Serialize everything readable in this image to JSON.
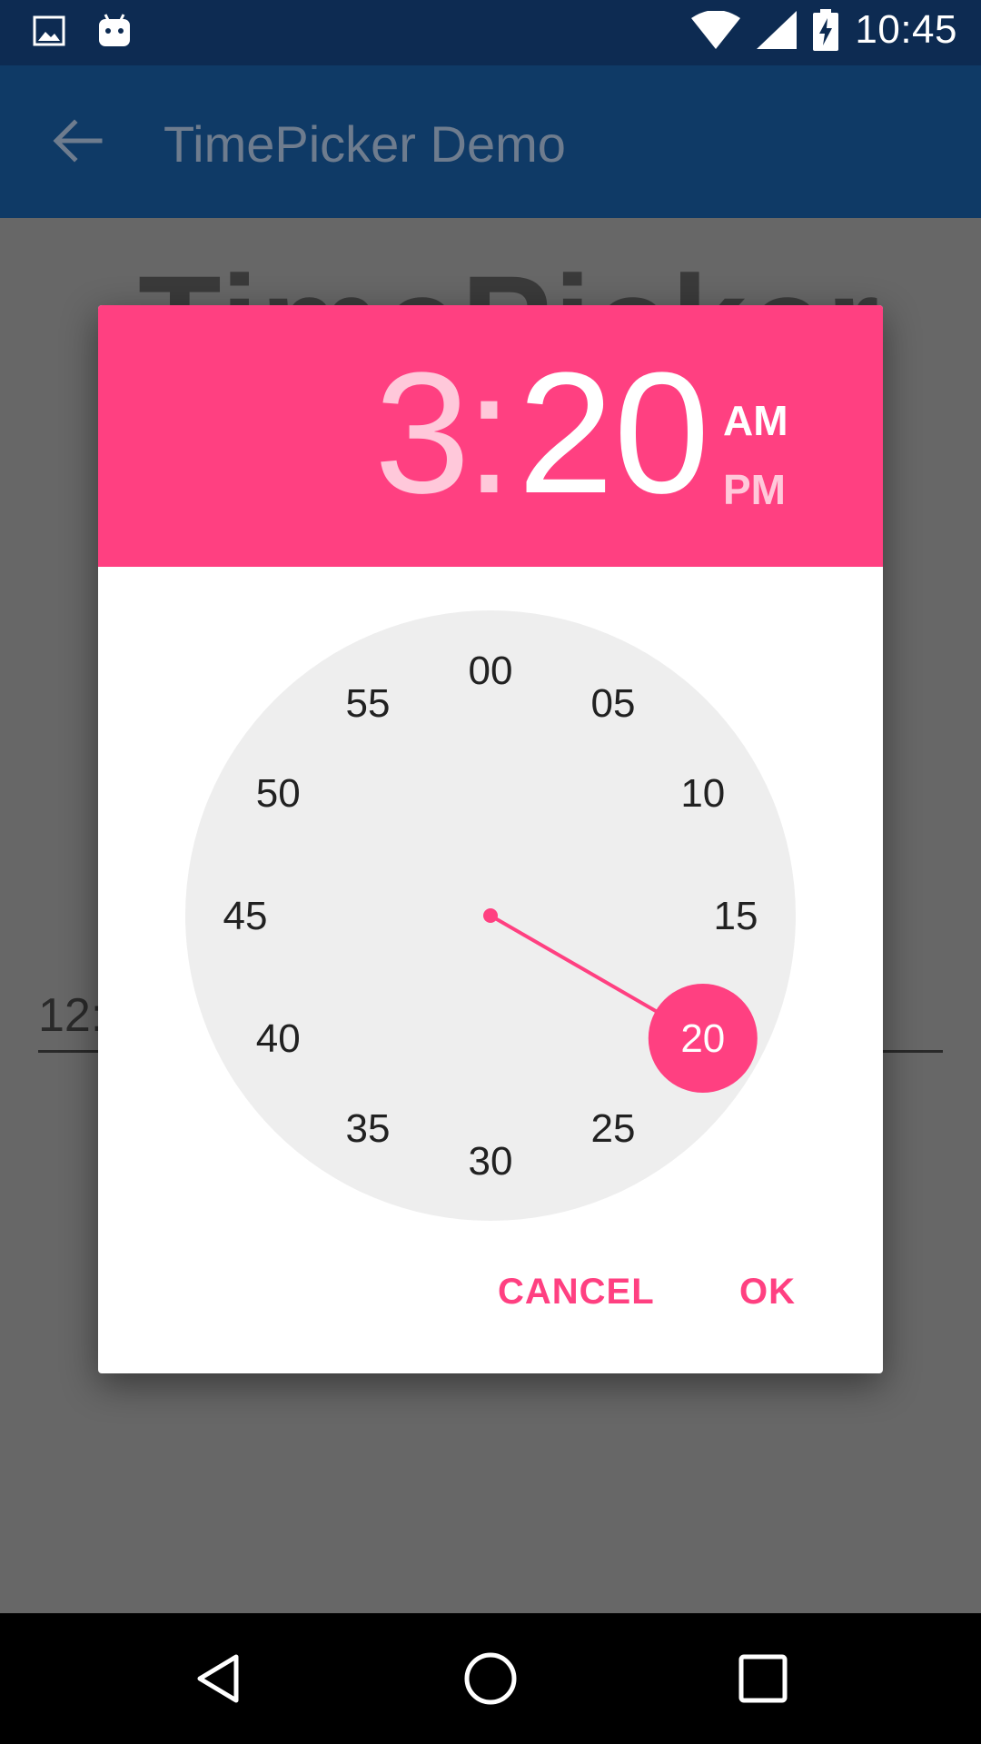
{
  "status_bar": {
    "time": "10:45",
    "icons": [
      "image-icon",
      "android-icon",
      "wifi-icon",
      "signal-icon",
      "battery-charging-icon"
    ]
  },
  "app_bar": {
    "title": "TimePicker Demo",
    "back_icon": "arrow-back-icon"
  },
  "background": {
    "heading": "TimePicker",
    "input_value": "12:"
  },
  "dialog": {
    "header": {
      "hour": "3",
      "separator": ":",
      "minute": "20",
      "am_label": "AM",
      "pm_label": "PM",
      "active_period": "AM"
    },
    "clock": {
      "mode": "minutes",
      "labels": [
        "00",
        "05",
        "10",
        "15",
        "20",
        "25",
        "30",
        "35",
        "40",
        "45",
        "50",
        "55"
      ],
      "selected": "20"
    },
    "buttons": {
      "cancel": "CANCEL",
      "ok": "OK"
    }
  },
  "nav_bar": {
    "icons": [
      "back-triangle-icon",
      "home-circle-icon",
      "recents-square-icon"
    ]
  },
  "colors": {
    "accent": "#ff4081",
    "accent_light": "#ffc8da",
    "status_bar": "#0d2b52",
    "app_bar": "#0f3a66",
    "clock_face": "#eeeeee"
  }
}
